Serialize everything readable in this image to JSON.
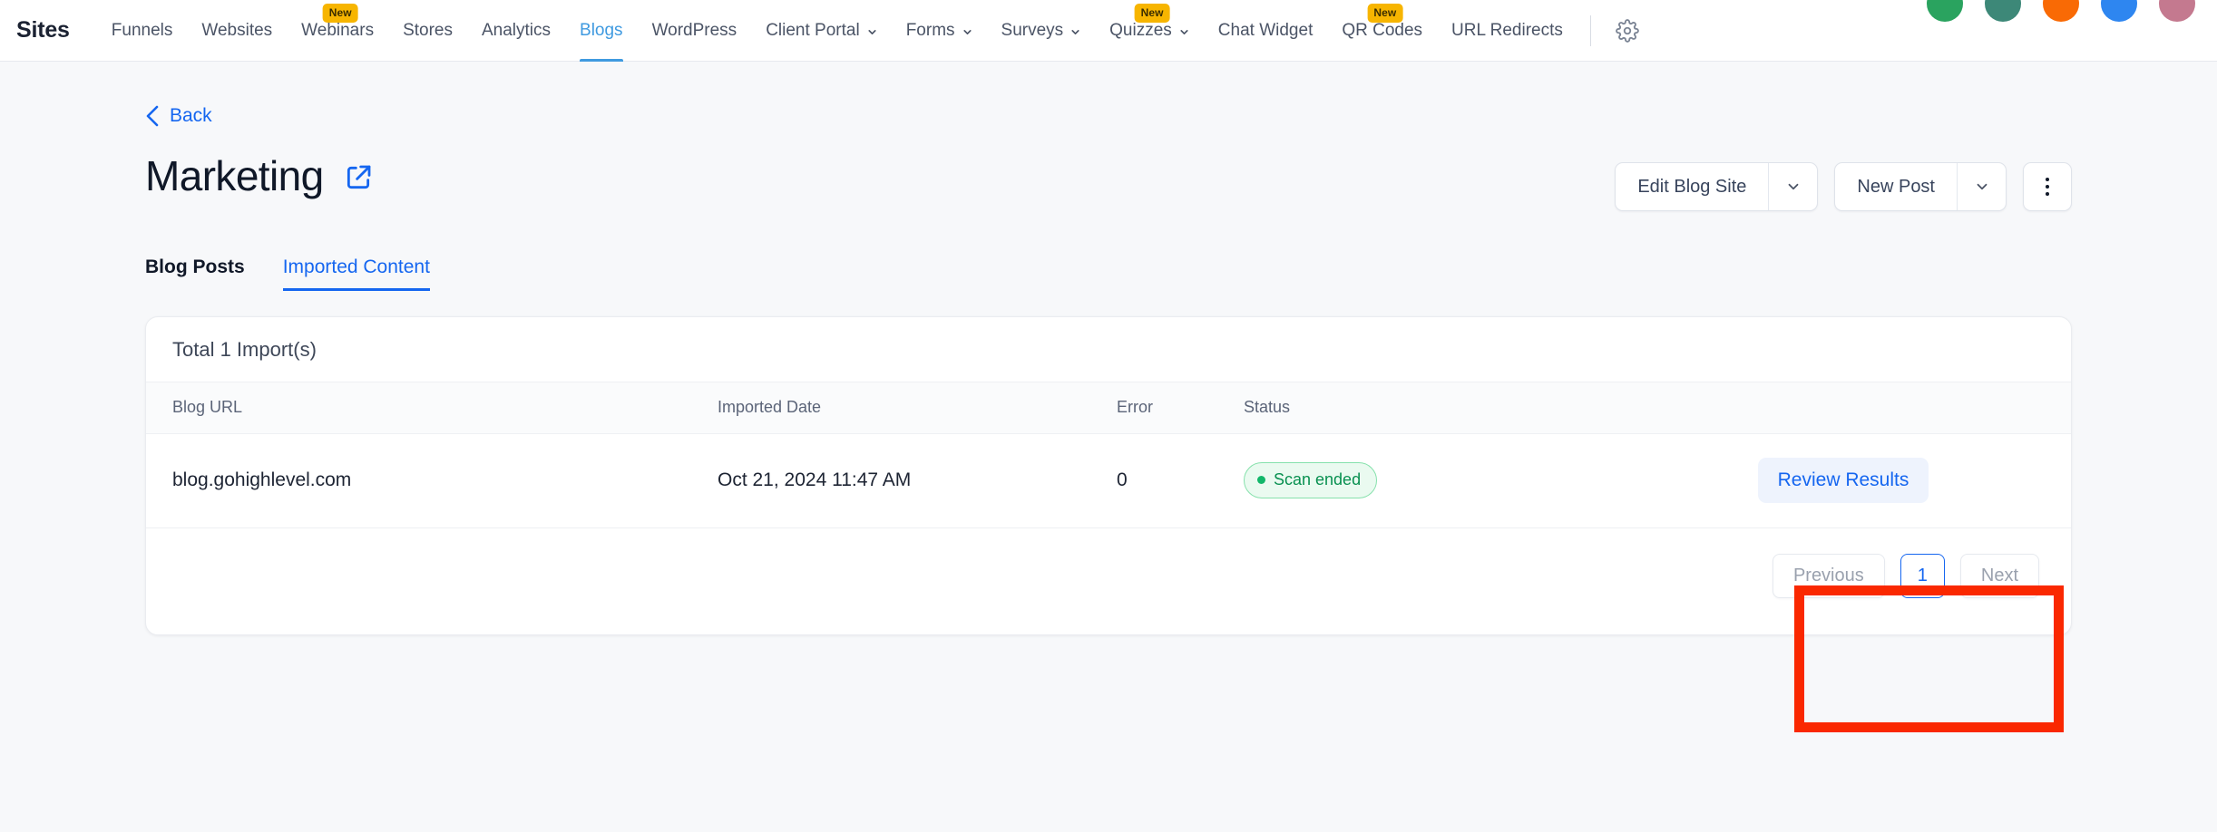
{
  "topbar": {
    "brand": "Sites",
    "avatars": [
      {
        "name": "avatar-1",
        "color": "#2aa35f"
      },
      {
        "name": "avatar-2",
        "color": "#3d8878"
      },
      {
        "name": "avatar-3",
        "color": "#f96a05"
      },
      {
        "name": "avatar-4",
        "color": "#2e86f0"
      },
      {
        "name": "avatar-5",
        "color": "#c4798f"
      }
    ],
    "nav": [
      {
        "label": "Funnels",
        "active": false,
        "caret": false,
        "badge": ""
      },
      {
        "label": "Websites",
        "active": false,
        "caret": false,
        "badge": ""
      },
      {
        "label": "Webinars",
        "active": false,
        "caret": false,
        "badge": "New"
      },
      {
        "label": "Stores",
        "active": false,
        "caret": false,
        "badge": ""
      },
      {
        "label": "Analytics",
        "active": false,
        "caret": false,
        "badge": ""
      },
      {
        "label": "Blogs",
        "active": true,
        "caret": false,
        "badge": ""
      },
      {
        "label": "WordPress",
        "active": false,
        "caret": false,
        "badge": ""
      },
      {
        "label": "Client Portal",
        "active": false,
        "caret": true,
        "badge": ""
      },
      {
        "label": "Forms",
        "active": false,
        "caret": true,
        "badge": ""
      },
      {
        "label": "Surveys",
        "active": false,
        "caret": true,
        "badge": ""
      },
      {
        "label": "Quizzes",
        "active": false,
        "caret": true,
        "badge": "New"
      },
      {
        "label": "Chat Widget",
        "active": false,
        "caret": false,
        "badge": ""
      },
      {
        "label": "QR Codes",
        "active": false,
        "caret": false,
        "badge": "New"
      },
      {
        "label": "URL Redirects",
        "active": false,
        "caret": false,
        "badge": ""
      }
    ],
    "settings_icon": "gear-icon",
    "active_accent": "#3f9ae0",
    "badge_color": "#f7b500"
  },
  "header": {
    "back_label": "Back",
    "title": "Marketing",
    "external_link_icon": "external-link-icon",
    "edit_blog_site_label": "Edit Blog Site",
    "new_post_label": "New Post",
    "more_menu_icon": "kebab-menu-icon",
    "accent": "#1566f0"
  },
  "tabs": [
    {
      "label": "Blog Posts",
      "active": false
    },
    {
      "label": "Imported Content",
      "active": true
    }
  ],
  "card": {
    "summary": "Total 1 Import(s)",
    "columns": [
      "Blog URL",
      "Imported Date",
      "Error",
      "Status",
      ""
    ],
    "rows": [
      {
        "blog_url": "blog.gohighlevel.com",
        "imported_date": "Oct 21, 2024 11:47 AM",
        "error": "0",
        "status": "Scan ended",
        "status_color": "#089050",
        "action_label": "Review Results"
      }
    ]
  },
  "pagination": {
    "previous_label": "Previous",
    "current_page": "1",
    "next_label": "Next"
  },
  "annotation": {
    "type": "highlight-rectangle",
    "color": "#fa2800",
    "targets": "review-results-button"
  }
}
